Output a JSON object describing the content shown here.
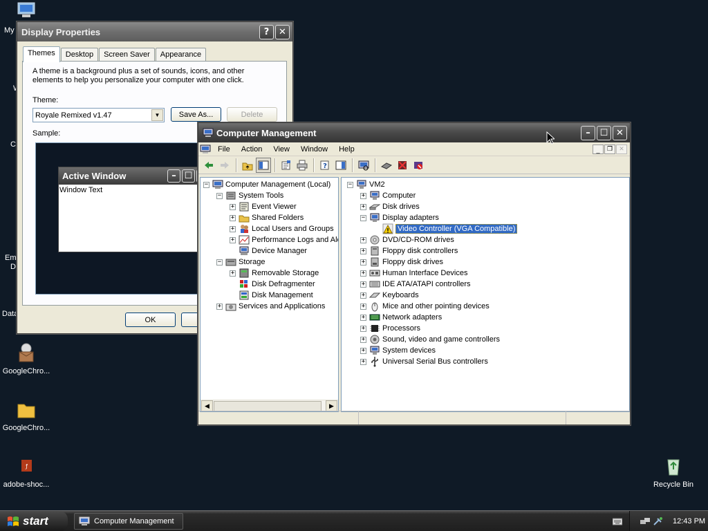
{
  "desktop": {
    "icons": [
      {
        "label": "GoogleChro..."
      },
      {
        "label": "GoogleChro..."
      },
      {
        "label": "adobe-shoc..."
      },
      {
        "label": "Recycle Bin"
      }
    ],
    "partial_labels": {
      "my": "My",
      "w": "W",
      "c": "C",
      "em": "Em",
      "d": "D",
      "data": "Data"
    }
  },
  "display_properties": {
    "title": "Display Properties",
    "tabs": [
      "Themes",
      "Desktop",
      "Screen Saver",
      "Appearance"
    ],
    "description": "A theme is a background plus a set of sounds, icons, and other elements to help you personalize your computer with one click.",
    "theme_label": "Theme:",
    "theme_value": "Royale Remixed v1.47",
    "save_as": "Save As...",
    "delete": "Delete",
    "sample_label": "Sample:",
    "sample_window_title": "Active Window",
    "sample_window_text": "Window Text",
    "ok": "OK"
  },
  "computer_management": {
    "title": "Computer Management",
    "menu": [
      "File",
      "Action",
      "View",
      "Window",
      "Help"
    ],
    "left_tree": [
      {
        "label": "Computer Management (Local)",
        "level": 0,
        "expander": "minus",
        "icon": "computer-management-icon"
      },
      {
        "label": "System Tools",
        "level": 1,
        "expander": "minus",
        "icon": "system-tools-icon"
      },
      {
        "label": "Event Viewer",
        "level": 2,
        "expander": "plus",
        "icon": "event-viewer-icon"
      },
      {
        "label": "Shared Folders",
        "level": 2,
        "expander": "plus",
        "icon": "shared-folders-icon"
      },
      {
        "label": "Local Users and Groups",
        "level": 2,
        "expander": "plus",
        "icon": "users-icon"
      },
      {
        "label": "Performance Logs and Alerts",
        "level": 2,
        "expander": "plus",
        "icon": "performance-icon"
      },
      {
        "label": "Device Manager",
        "level": 2,
        "expander": "none",
        "icon": "device-manager-icon"
      },
      {
        "label": "Storage",
        "level": 1,
        "expander": "minus",
        "icon": "storage-icon"
      },
      {
        "label": "Removable Storage",
        "level": 2,
        "expander": "plus",
        "icon": "removable-storage-icon"
      },
      {
        "label": "Disk Defragmenter",
        "level": 2,
        "expander": "none",
        "icon": "defrag-icon"
      },
      {
        "label": "Disk Management",
        "level": 2,
        "expander": "none",
        "icon": "disk-management-icon"
      },
      {
        "label": "Services and Applications",
        "level": 1,
        "expander": "plus",
        "icon": "services-icon"
      }
    ],
    "right_tree": [
      {
        "label": "VM2",
        "level": 0,
        "expander": "minus",
        "icon": "computer-icon"
      },
      {
        "label": "Computer",
        "level": 1,
        "expander": "plus",
        "icon": "computer-icon"
      },
      {
        "label": "Disk drives",
        "level": 1,
        "expander": "plus",
        "icon": "disk-drive-icon"
      },
      {
        "label": "Display adapters",
        "level": 1,
        "expander": "minus",
        "icon": "display-adapter-icon"
      },
      {
        "label": "Video Controller (VGA Compatible)",
        "level": 2,
        "expander": "none",
        "icon": "warning-icon",
        "selected": true
      },
      {
        "label": "DVD/CD-ROM drives",
        "level": 1,
        "expander": "plus",
        "icon": "cdrom-icon"
      },
      {
        "label": "Floppy disk controllers",
        "level": 1,
        "expander": "plus",
        "icon": "controller-icon"
      },
      {
        "label": "Floppy disk drives",
        "level": 1,
        "expander": "plus",
        "icon": "floppy-icon"
      },
      {
        "label": "Human Interface Devices",
        "level": 1,
        "expander": "plus",
        "icon": "hid-icon"
      },
      {
        "label": "IDE ATA/ATAPI controllers",
        "level": 1,
        "expander": "plus",
        "icon": "ide-icon"
      },
      {
        "label": "Keyboards",
        "level": 1,
        "expander": "plus",
        "icon": "keyboard-icon"
      },
      {
        "label": "Mice and other pointing devices",
        "level": 1,
        "expander": "plus",
        "icon": "mouse-icon"
      },
      {
        "label": "Network adapters",
        "level": 1,
        "expander": "plus",
        "icon": "network-icon"
      },
      {
        "label": "Processors",
        "level": 1,
        "expander": "plus",
        "icon": "processor-icon"
      },
      {
        "label": "Sound, video and game controllers",
        "level": 1,
        "expander": "plus",
        "icon": "sound-icon"
      },
      {
        "label": "System devices",
        "level": 1,
        "expander": "plus",
        "icon": "system-devices-icon"
      },
      {
        "label": "Universal Serial Bus controllers",
        "level": 1,
        "expander": "plus",
        "icon": "usb-icon"
      }
    ]
  },
  "taskbar": {
    "start": "start",
    "task_label": "Computer Management",
    "clock": "12:43 PM"
  }
}
